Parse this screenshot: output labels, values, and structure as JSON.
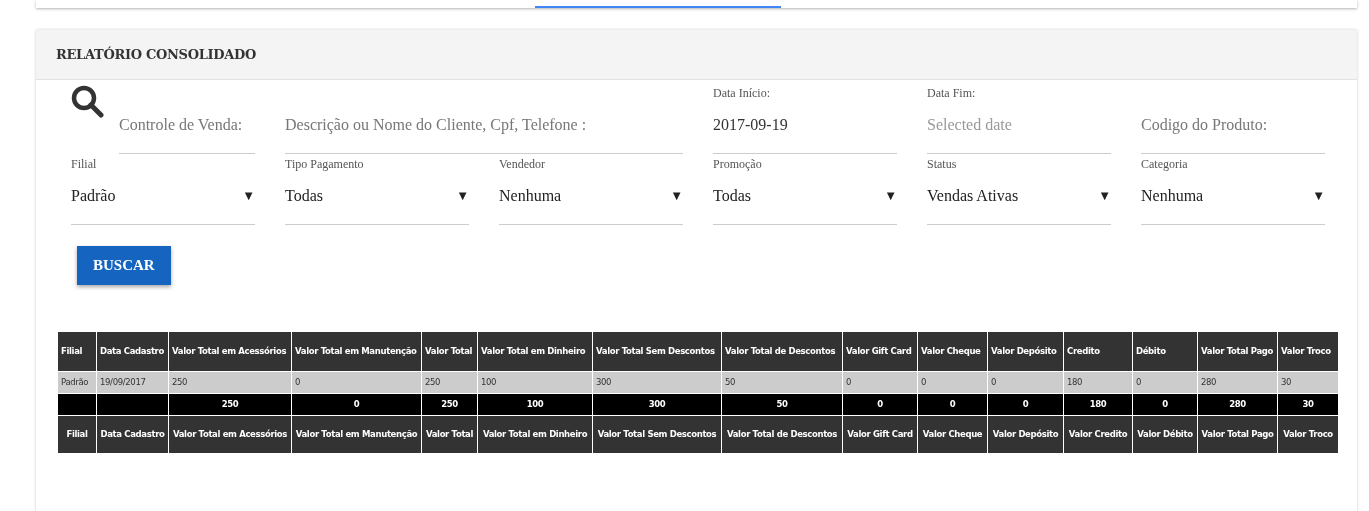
{
  "panel": {
    "title": "RELATÓRIO CONSOLIDADO"
  },
  "filters_top": [
    {
      "kind": "text",
      "placeholder": "Controle de Venda:"
    },
    {
      "kind": "widetext",
      "placeholder": "Descrição ou Nome do Cliente, Cpf, Telefone :"
    },
    {
      "kind": "date",
      "label": "Data Início:",
      "value": "2017-09-19"
    },
    {
      "kind": "date",
      "label": "Data Fim:",
      "placeholder": "Selected date"
    },
    {
      "kind": "text",
      "placeholder": "Codigo do Produto:"
    }
  ],
  "filters_select": [
    {
      "label": "Filial",
      "value": "Padrão"
    },
    {
      "label": "Tipo Pagamento",
      "value": "Todas"
    },
    {
      "label": "Vendedor",
      "value": "Nenhuma"
    },
    {
      "label": "Promoção",
      "value": "Todas"
    },
    {
      "label": "Status",
      "value": "Vendas Ativas"
    },
    {
      "label": "Categoria",
      "value": "Nenhuma"
    }
  ],
  "dropdown_arrow": "▼",
  "search_button": "BUSCAR",
  "table": {
    "columns": [
      "Filial",
      "Data Cadastro",
      "Valor Total em Acessórios",
      "Valor Total em Manutenção",
      "Valor Total",
      "Valor Total em Dinheiro",
      "Valor Total Sem Descontos",
      "Valor Total de Descontos",
      "Valor Gift Card",
      "Valor Cheque",
      "Valor Depósito",
      "Credito",
      "Débito",
      "Valor Total Pago",
      "Valor Troco"
    ],
    "rows": [
      [
        "Padrão",
        "19/09/2017",
        "250",
        "0",
        "250",
        "100",
        "300",
        "50",
        "0",
        "0",
        "0",
        "180",
        "0",
        "280",
        "30"
      ]
    ],
    "totals": [
      "250",
      "0",
      "250",
      "100",
      "300",
      "50",
      "0",
      "0",
      "0",
      "180",
      "0",
      "280",
      "30"
    ],
    "footer_columns": [
      "Filial",
      "Data Cadastro",
      "Valor Total em Acessórios",
      "Valor Total em Manutenção",
      "Valor Total",
      "Valor Total em Dinheiro",
      "Valor Total Sem Descontos",
      "Valor Total de Descontos",
      "Valor Gift Card",
      "Valor Cheque",
      "Valor Depósito",
      "Valor Credito",
      "Valor Débito",
      "Valor Total Pago",
      "Valor Troco"
    ]
  }
}
